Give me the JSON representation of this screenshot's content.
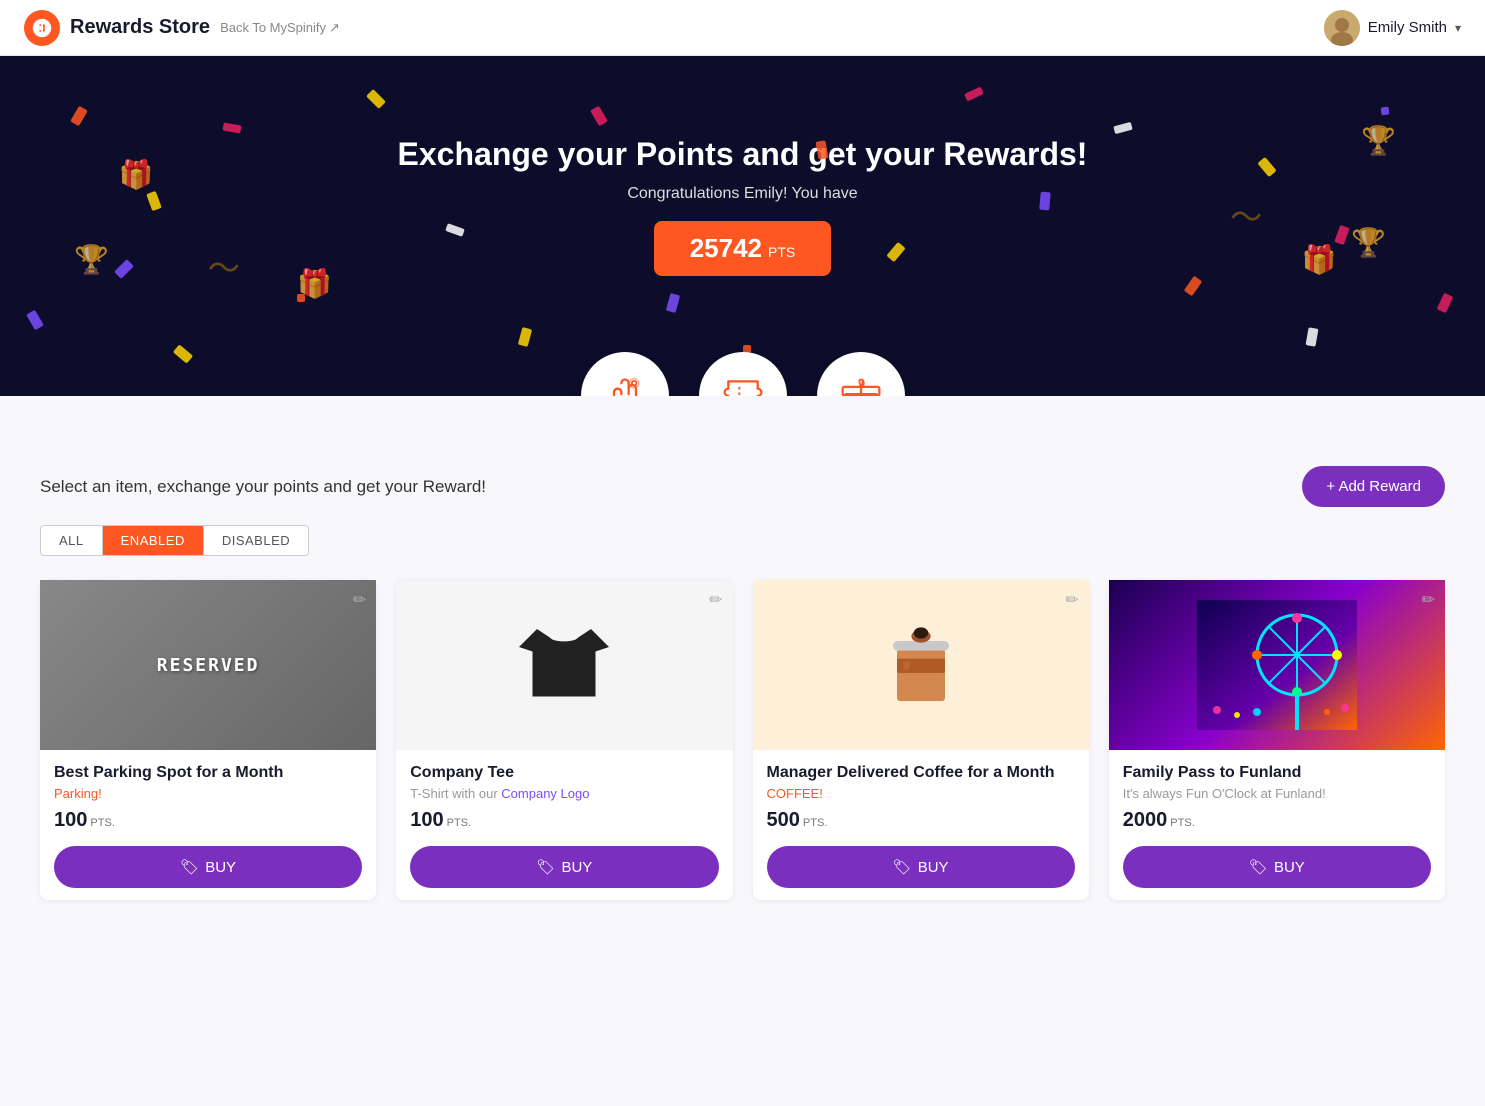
{
  "header": {
    "logo_text": "Rewards Store",
    "back_link": "Back To MySpinify",
    "user_name": "Emily Smith",
    "chevron": "▾"
  },
  "hero": {
    "title": "Exchange your Points and get your Rewards!",
    "subtitle_prefix": "Congratulations Emily! You have",
    "points": "25742",
    "pts_label": "PTS"
  },
  "icons": [
    {
      "name": "hand-icon",
      "label": "Hand"
    },
    {
      "name": "ticket-icon",
      "label": "Ticket"
    },
    {
      "name": "gift-icon",
      "label": "Gift"
    }
  ],
  "section": {
    "title": "Select an item, exchange your points and get your Reward!",
    "add_reward_label": "+ Add Reward"
  },
  "filters": [
    {
      "id": "all",
      "label": "ALL",
      "active": false
    },
    {
      "id": "enabled",
      "label": "ENABLED",
      "active": true
    },
    {
      "id": "disabled",
      "label": "DISABLED",
      "active": false
    }
  ],
  "products": [
    {
      "id": "parking",
      "name": "Best Parking Spot for a Month",
      "category": "Parking!",
      "description": "",
      "points": "100",
      "pts_label": "PTS.",
      "buy_label": "BUY",
      "image_type": "parking"
    },
    {
      "id": "tshirt",
      "name": "Company Tee",
      "category": "",
      "description": "T-Shirt with our Company Logo",
      "points": "100",
      "pts_label": "PTS.",
      "buy_label": "BUY",
      "image_type": "tshirt"
    },
    {
      "id": "coffee",
      "name": "Manager Delivered Coffee for a Month",
      "category": "COFFEE!",
      "description": "",
      "points": "500",
      "pts_label": "PTS.",
      "buy_label": "BUY",
      "image_type": "coffee"
    },
    {
      "id": "funland",
      "name": "Family Pass to Funland",
      "category": "",
      "description": "It's always Fun O'Clock at Funland!",
      "points": "2000",
      "pts_label": "PTS.",
      "buy_label": "BUY",
      "image_type": "funland"
    }
  ]
}
